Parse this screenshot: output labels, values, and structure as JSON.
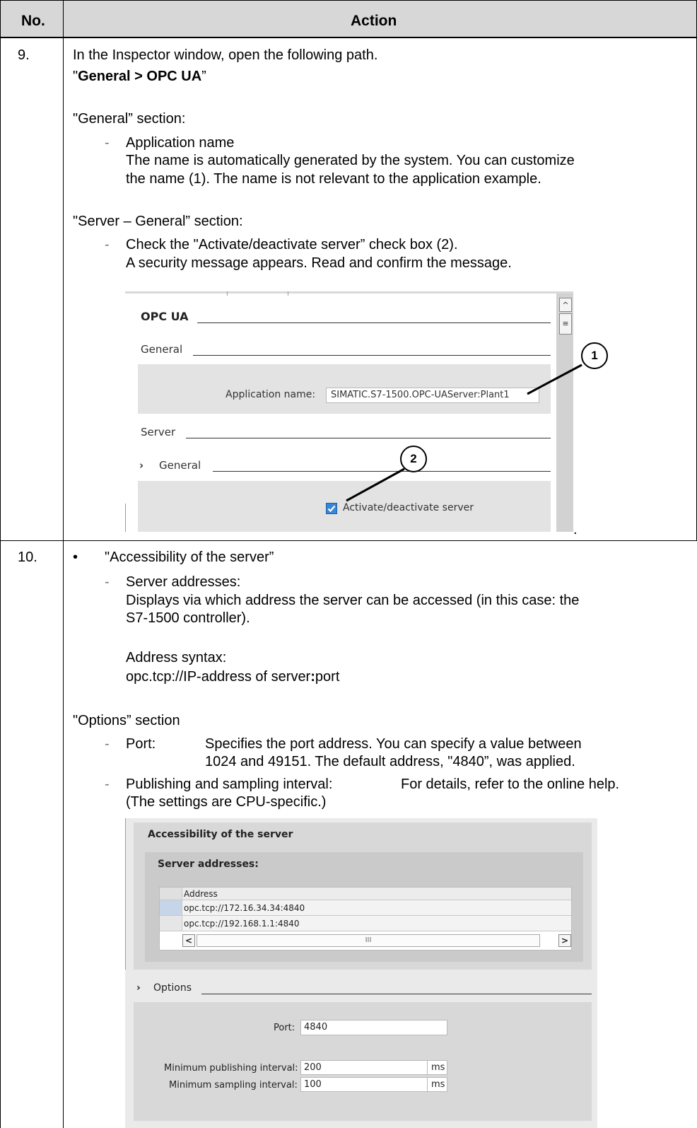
{
  "table": {
    "header_no": "No.",
    "header_action": "Action"
  },
  "step9": {
    "no": "9.",
    "line1": "In the Inspector window, open the following path.",
    "path_open": "\"",
    "path_bold": "General > OPC UA",
    "path_close": "”",
    "general_section": "\"General” section:",
    "dash": "-",
    "app_name_item": "Application name",
    "app_name_desc1": "The name is automatically generated by the system. You can customize",
    "app_name_desc2": "the name (1). The name is not relevant to the application example.",
    "server_general_section": "\"Server – General” section:",
    "check_item1": "Check the \"Activate/deactivate server” check box (2).",
    "check_item2": "A security message appears. Read and confirm the message.",
    "trailing_dot": ".",
    "screenshot": {
      "opc_ua_heading": "OPC UA",
      "general_heading": "General",
      "app_name_label": "Application name:",
      "app_name_value": "SIMATIC.S7-1500.OPC-UAServer:Plant1",
      "server_heading": "Server",
      "chevron": "›",
      "server_general_heading": "General",
      "activate_label": "Activate/deactivate server",
      "activate_checked": true,
      "callout1": "1",
      "callout2": "2",
      "scroll_up": "^",
      "scroll_grip": "≡"
    }
  },
  "step10": {
    "no": "10.",
    "bullet": "•",
    "accessibility": "\"Accessibility of the server”",
    "dash": "-",
    "server_addresses_item": "Server addresses:",
    "server_addresses_desc1": "Displays via which address the server can be accessed (in this case: the",
    "server_addresses_desc2": "S7-1500 controller).",
    "syntax_label": "Address syntax:",
    "syntax_part1": "opc.tcp://IP-address of server",
    "syntax_colon": ":",
    "syntax_part2": "port",
    "options_section": "\"Options” section",
    "port_item": "Port:",
    "port_desc1": "Specifies the port address. You can specify a value between",
    "port_desc2": "1024 and 49151. The default address, \"4840”, was applied.",
    "publish_item": "Publishing and sampling interval:",
    "publish_desc": "For details, refer to the online help.",
    "publish_note": "(The settings are CPU-specific.)",
    "screenshot": {
      "accessibility_heading": "Accessibility of the server",
      "server_addresses_heading": "Server addresses:",
      "address_col": "Address",
      "addresses": [
        "opc.tcp://172.16.34.34:4840",
        "opc.tcp://192.168.1.1:4840"
      ],
      "scroll_left": "<",
      "scroll_mid": "III",
      "scroll_right": ">",
      "chevron": "›",
      "options_heading": "Options",
      "port_label": "Port:",
      "port_value": "4840",
      "min_pub_label": "Minimum publishing interval:",
      "min_pub_value": "200",
      "min_samp_label": "Minimum sampling interval:",
      "min_samp_value": "100",
      "unit": "ms"
    }
  }
}
